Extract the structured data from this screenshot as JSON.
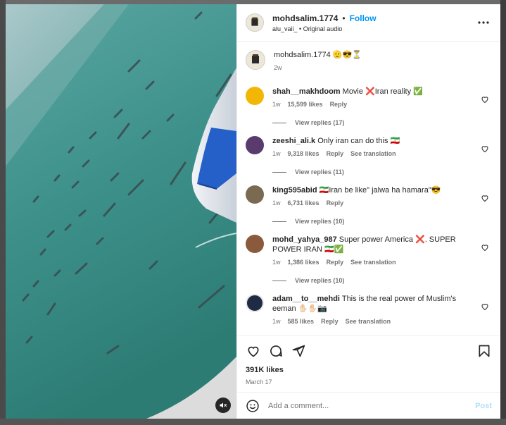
{
  "post": {
    "author": "mohdsalim.1774",
    "separator": "•",
    "follow_label": "Follow",
    "audio_user": "alu_vaii_",
    "audio_sep": "•",
    "audio_label": "Original audio",
    "caption_text": "mohdsalim.1774 🫡😎⏳",
    "caption_age": "2w"
  },
  "comments": [
    {
      "user": "shah__makhdoom",
      "text": "Movie ❌Iran reality ✅",
      "age": "1w",
      "likes": "15,599 likes",
      "reply": "Reply",
      "translate": "",
      "view_replies": "View replies (17)",
      "avatar_color": "#f2b705"
    },
    {
      "user": "zeeshi_ali.k",
      "text": "Only iran can do this 🇮🇷",
      "age": "1w",
      "likes": "9,318 likes",
      "reply": "Reply",
      "translate": "See translation",
      "view_replies": "View replies (11)",
      "avatar_color": "#5a3b6e"
    },
    {
      "user": "king595abid",
      "text": "🇮🇷Iran be like\" jalwa ha hamara\"😎",
      "age": "1w",
      "likes": "6,731 likes",
      "reply": "Reply",
      "translate": "",
      "view_replies": "View replies (10)",
      "avatar_color": "#7a6a52"
    },
    {
      "user": "mohd_yahya_987",
      "text": "Super power America ❌. SUPER POWER IRAN 🇮🇷✅",
      "age": "1w",
      "likes": "1,386 likes",
      "reply": "Reply",
      "translate": "See translation",
      "view_replies": "View replies (10)",
      "avatar_color": "#8a5a3c"
    },
    {
      "user": "adam__to__mehdi",
      "text": "This is the real power of Muslim's eeman ✋🏻✋🏻📷",
      "age": "1w",
      "likes": "585 likes",
      "reply": "Reply",
      "translate": "See translation",
      "view_replies": "",
      "avatar_color": "#1f2a44"
    }
  ],
  "actions": {
    "likes": "391K likes",
    "date": "March 17"
  },
  "composer": {
    "placeholder": "Add a comment...",
    "post_label": "Post"
  },
  "colors": {
    "accent": "#0095f6",
    "text": "#262626",
    "muted": "#737373"
  }
}
